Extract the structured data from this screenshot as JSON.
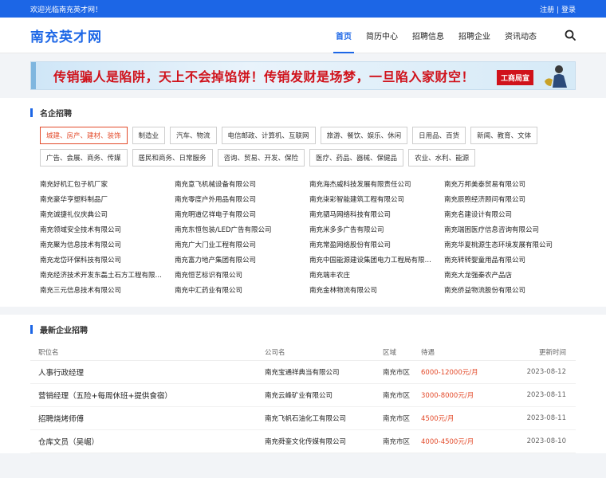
{
  "topbar": {
    "welcome": "欢迎光临南充英才网！",
    "register": "注册",
    "separator": "|",
    "login": "登录"
  },
  "header": {
    "logo": "南充英才网",
    "nav": [
      "首页",
      "简历中心",
      "招聘信息",
      "招聘企业",
      "资讯动态"
    ],
    "active_index": 0
  },
  "banner": {
    "text": "传销骗人是陷阱，天上不会掉馅饼！传销发财是场梦，一旦陷入家财空！",
    "seal": "工商局宣"
  },
  "famous": {
    "title": "名企招聘",
    "categories": [
      "城建、房产、建材、装饰",
      "制造业",
      "汽车、物流",
      "电信邮政、计算机、互联网",
      "旅游、餐饮、娱乐、休闲",
      "日用品、百货",
      "新闻、教育、文体",
      "广告、会展、商务、传媒",
      "居民和商务、日常服务",
      "咨询、贸易、开发、保险",
      "医疗、药品、器械、保健品",
      "农业、水利、能源"
    ],
    "active_category": 0,
    "companies": [
      "南充好机汇包子机厂家",
      "南充意飞机械设备有限公司",
      "南充海杰威科技发展有限责任公司",
      "南充万邦美泰贸易有限公司",
      "南充豪华亨塑料制品厂",
      "南充零度户外用品有限公司",
      "南充柒彩智能建筑工程有限公司",
      "南充辰煦经济顾问有限公司",
      "南充诚捷礼仪庆典公司",
      "南充明道亿祥电子有限公司",
      "南充驷马网络科技有限公司",
      "南充名建设计有限公司",
      "南充领域安全技术有限公司",
      "南充东恒包装/LED广告有限公司",
      "南充米多多广告有限公司",
      "南充瑞困医疗信息咨询有限公司",
      "南充聚为信息技术有限公司",
      "南充广大门业工程有限公司",
      "南充常盈网络股份有限公司",
      "南充华夏桃源生态环境发展有限公司",
      "南充龙岱环保科技有限公司",
      "南充富力地产集团有限公司",
      "南充中国能源建设集团电力工程局有限公司",
      "南充转转婴童用品有限公司",
      "南充经济技术开发东磊土石方工程有限公司",
      "南充恒艺标识有限公司",
      "南充端丰农庄",
      "南充大龙强秦农产品店",
      "南充三元信息技术有限公司",
      "南充中汇药业有限公司",
      "南充金林物流有限公司",
      "南充侨益物流股份有限公司"
    ]
  },
  "jobs": {
    "title": "最新企业招聘",
    "headers": {
      "title": "职位名",
      "company": "公司名",
      "area": "区域",
      "pay": "待遇",
      "date": "更新时间"
    },
    "rows": [
      {
        "title": "人事行政经理",
        "company": "南充宝通祥典当有限公司",
        "area": "南充市区",
        "pay": "6000-12000元/月",
        "date": "2023-08-12"
      },
      {
        "title": "营销经理（五险+每周休班+提供食宿）",
        "company": "南充云峰矿业有限公司",
        "area": "南充市区",
        "pay": "3000-8000元/月",
        "date": "2023-08-11"
      },
      {
        "title": "招聘烧烤师傅",
        "company": "南充飞帆石油化工有限公司",
        "area": "南充市区",
        "pay": "4500元/月",
        "date": "2023-08-11"
      },
      {
        "title": "仓库文员（吴崛）",
        "company": "南充舜銮文化传媒有限公司",
        "area": "南充市区",
        "pay": "4000-4500元/月",
        "date": "2023-08-10"
      }
    ]
  },
  "colors": {
    "brand": "#1c66e6",
    "accent": "#e34b2b",
    "banner_text": "#d0121b"
  }
}
